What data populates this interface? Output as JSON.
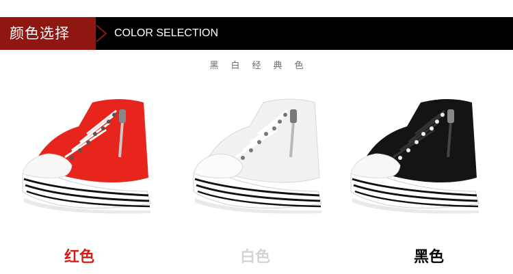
{
  "banner": {
    "title_cn": "颜色选择",
    "title_en": "COLOR SELECTION",
    "accent_color": "#8e1712"
  },
  "subtitle": "黑白经典色",
  "products": [
    {
      "label": "红色",
      "color": "#d51c14",
      "shoe_color": "#e8251c"
    },
    {
      "label": "白色",
      "color": "#d4d4d4",
      "shoe_color": "#f4f4f4"
    },
    {
      "label": "黑色",
      "color": "#000000",
      "shoe_color": "#141414"
    }
  ]
}
